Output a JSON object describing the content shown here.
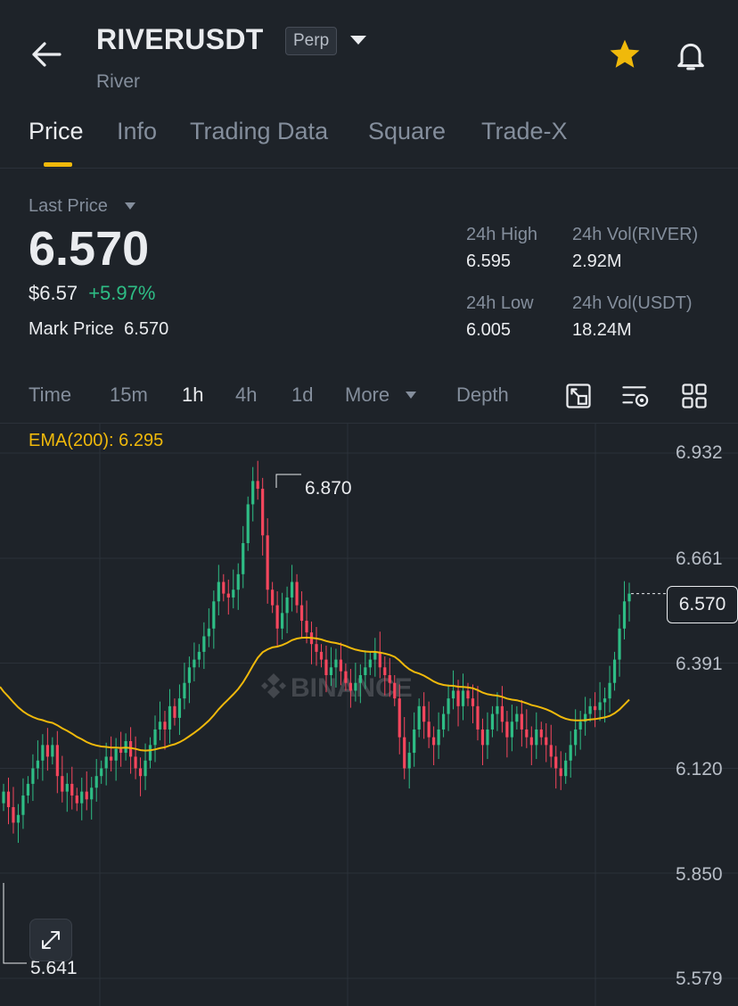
{
  "header": {
    "symbol": "RIVERUSDT",
    "badge": "Perp",
    "subtitle": "River"
  },
  "tabs": [
    {
      "label": "Price",
      "active": true
    },
    {
      "label": "Info"
    },
    {
      "label": "Trading Data"
    },
    {
      "label": "Square"
    },
    {
      "label": "Trade-X"
    }
  ],
  "stats": {
    "last_price_label": "Last Price",
    "last_price": "6.570",
    "usd_price": "$6.57",
    "change": "+5.97%",
    "mark_price_label": "Mark Price",
    "mark_price": "6.570",
    "high_label": "24h High",
    "high": "6.595",
    "vol_river_label": "24h Vol(RIVER)",
    "vol_river": "2.92M",
    "low_label": "24h Low",
    "low": "6.005",
    "vol_usdt_label": "24h Vol(USDT)",
    "vol_usdt": "18.24M"
  },
  "intervals": [
    "Time",
    "15m",
    "1h",
    "4h",
    "1d",
    "More",
    "Depth"
  ],
  "active_interval": "1h",
  "colors": {
    "up": "#2ebd85",
    "down": "#f6465d",
    "ema": "#f0b90b",
    "accent": "#f0b90b"
  },
  "chart_data": {
    "type": "candlestick",
    "indicator_label": "EMA(200): 6.295",
    "ema_value": 6.295,
    "y_axis_ticks": [
      "6.932",
      "6.661",
      "6.391",
      "6.120",
      "5.850",
      "5.579"
    ],
    "ylim": [
      5.579,
      6.932
    ],
    "current_price": "6.570",
    "high_marker": "6.870",
    "low_marker": "5.641",
    "watermark": "BINANCE",
    "close_series": [
      6.06,
      6.02,
      5.98,
      6.0,
      6.05,
      6.08,
      6.12,
      6.14,
      6.18,
      6.15,
      6.18,
      6.1,
      6.06,
      6.08,
      6.05,
      6.03,
      6.06,
      6.04,
      6.07,
      6.1,
      6.12,
      6.15,
      6.14,
      6.17,
      6.16,
      6.19,
      6.15,
      6.12,
      6.1,
      6.14,
      6.18,
      6.22,
      6.24,
      6.22,
      6.28,
      6.25,
      6.3,
      6.34,
      6.38,
      6.4,
      6.42,
      6.46,
      6.48,
      6.55,
      6.6,
      6.57,
      6.56,
      6.58,
      6.62,
      6.7,
      6.8,
      6.86,
      6.84,
      6.72,
      6.58,
      6.54,
      6.48,
      6.52,
      6.56,
      6.6,
      6.54,
      6.5,
      6.47,
      6.44,
      6.42,
      6.4,
      6.36,
      6.38,
      6.4,
      6.37,
      6.34,
      6.32,
      6.34,
      6.36,
      6.38,
      6.4,
      6.42,
      6.38,
      6.36,
      6.34,
      6.3,
      6.2,
      6.12,
      6.16,
      6.22,
      6.28,
      6.24,
      6.2,
      6.18,
      6.22,
      6.26,
      6.3,
      6.32,
      6.28,
      6.32,
      6.3,
      6.28,
      6.22,
      6.18,
      6.22,
      6.26,
      6.28,
      6.24,
      6.2,
      6.24,
      6.26,
      6.22,
      6.2,
      6.18,
      6.22,
      6.2,
      6.18,
      6.15,
      6.12,
      6.1,
      6.14,
      6.18,
      6.22,
      6.24,
      6.26,
      6.28,
      6.27,
      6.29,
      6.3,
      6.34,
      6.4,
      6.48,
      6.55,
      6.57
    ]
  }
}
